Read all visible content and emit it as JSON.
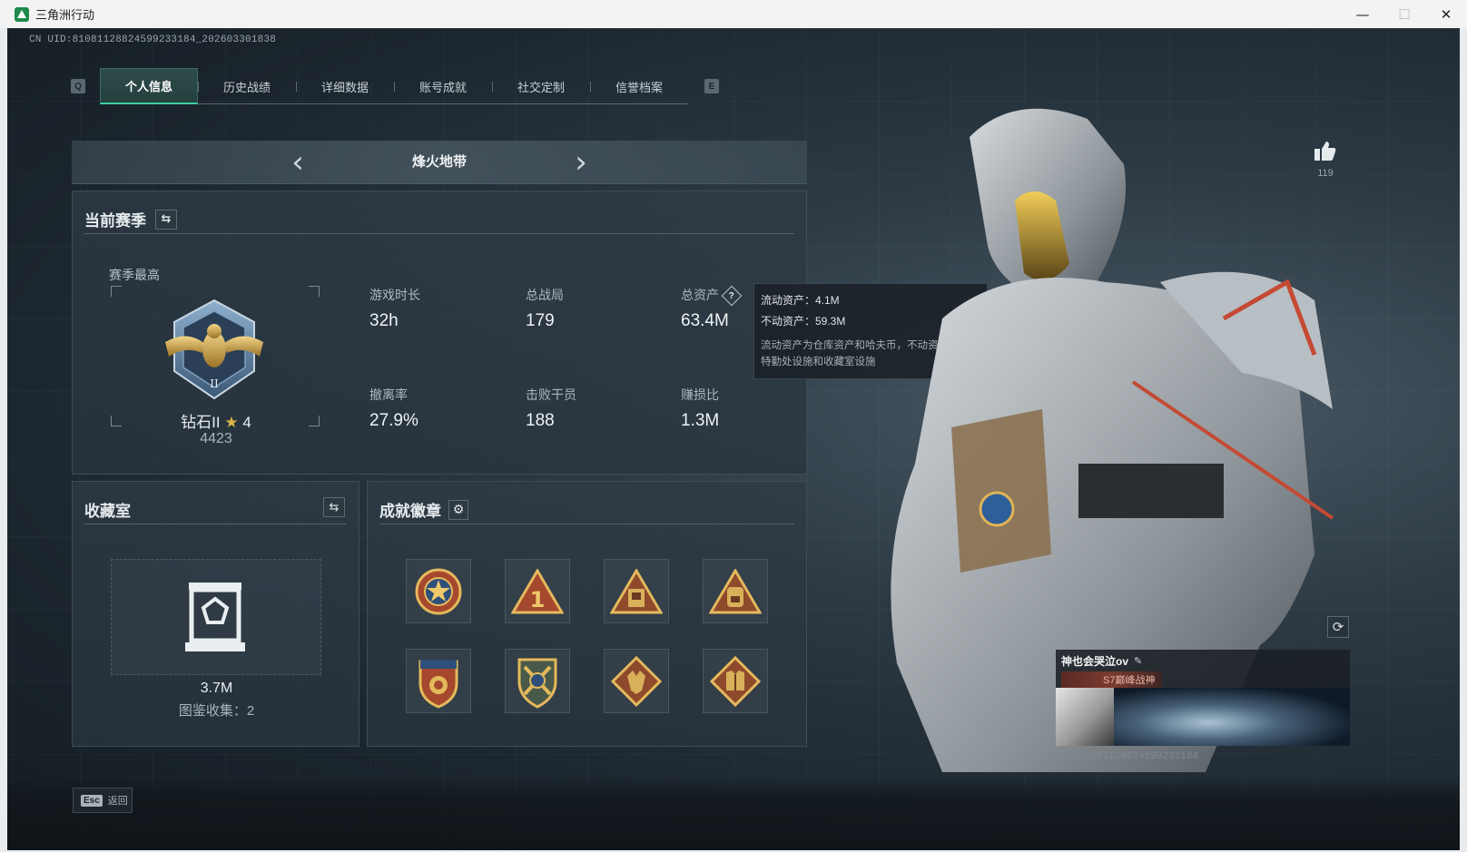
{
  "window": {
    "title": "三角洲行动",
    "minimize": "—",
    "maximize": "☐",
    "close": "✕"
  },
  "uid_text": "CN UID:8108112882459923318​4_202603301838",
  "tabs": {
    "left_key": "Q",
    "right_key": "E",
    "items": [
      {
        "label": "个人信息",
        "active": true
      },
      {
        "label": "历史战绩"
      },
      {
        "label": "详细数据"
      },
      {
        "label": "账号成就"
      },
      {
        "label": "社交定制"
      },
      {
        "label": "信誉档案"
      }
    ]
  },
  "mode": {
    "title": "烽火地带",
    "prev": "‹",
    "next": "›"
  },
  "season": {
    "title": "当前赛季",
    "best_label": "赛季最高",
    "rank_name": "钻石II",
    "rank_star": "★",
    "rank_stars_count": "4",
    "rank_score": "4423",
    "stats": [
      {
        "label": "游戏时长",
        "value": "32h"
      },
      {
        "label": "总战局",
        "value": "179"
      },
      {
        "label": "总资产",
        "value": "63.4M",
        "help": "?"
      },
      {
        "label": "撤离率",
        "value": "27.9%"
      },
      {
        "label": "击败干员",
        "value": "188"
      },
      {
        "label": "赚损比",
        "value": "1.3M"
      }
    ]
  },
  "tooltip": {
    "liquid": "流动资产：4.1M",
    "fixed": "不动资产：59.3M",
    "description_line1": "流动资产为仓库资产和哈夫币，不动资产为",
    "description_line2": "特勤处设施和收藏室设施"
  },
  "collection": {
    "title": "收藏室",
    "value": "3.7M",
    "count": "图鉴收集：2"
  },
  "badges": {
    "title": "成就徽章",
    "items": [
      "star-medal",
      "rank-1-triangle",
      "vault-triangle",
      "backpack-triangle",
      "stars-shield",
      "crossed-shield",
      "wolf-diamond",
      "vest-diamond"
    ]
  },
  "likes": {
    "count": "119"
  },
  "player": {
    "name": "神也会哭泣ov",
    "title": "S7巅峰战神",
    "uid": "编号8108112882459923318​4"
  },
  "footer": {
    "key": "Esc",
    "label": "返回"
  },
  "colors": {
    "accent": "#3fd1a0",
    "gold": "#d9b44a",
    "panel": "#2e3a44"
  }
}
